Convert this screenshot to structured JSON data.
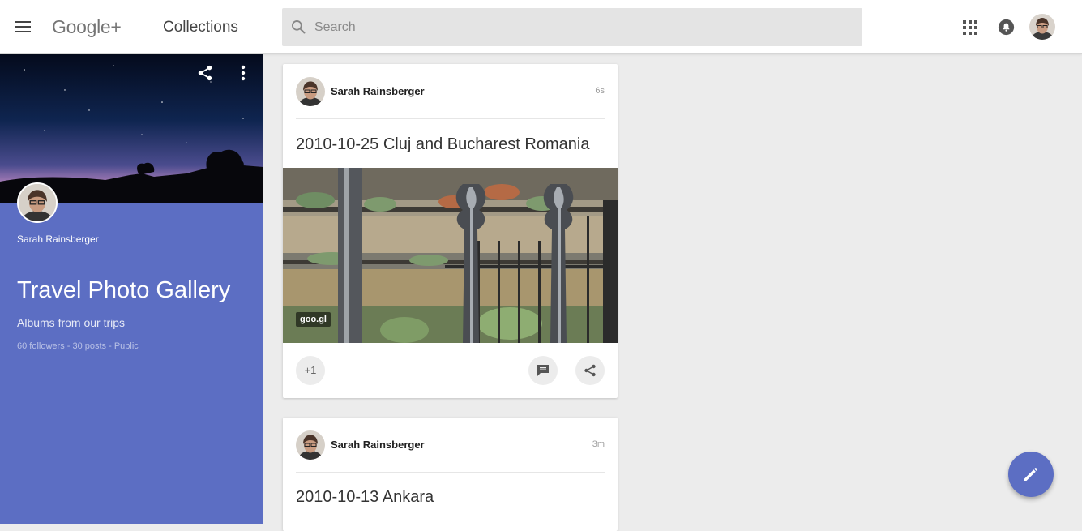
{
  "header": {
    "logo": "Google+",
    "section_title": "Collections",
    "search_placeholder": "Search"
  },
  "collection": {
    "owner_name": "Sarah Rainsberger",
    "title": "Travel Photo Gallery",
    "description": "Albums from our trips",
    "stats": "60 followers - 30 posts - Public"
  },
  "posts": [
    {
      "author": "Sarah Rainsberger",
      "time": "6s",
      "title": "2010-10-25 Cluj and Bucharest Romania",
      "image_tag": "goo.gl",
      "plus_one": "+1"
    },
    {
      "author": "Sarah Rainsberger",
      "time": "3m",
      "title": "2010-10-13 Ankara"
    }
  ],
  "colors": {
    "accent": "#5c6ec3",
    "background": "#ececec"
  },
  "icons": {
    "menu": "menu-icon",
    "search": "search-icon",
    "apps": "apps-grid-icon",
    "notifications": "notification-bell-icon",
    "share": "share-icon",
    "more": "more-vert-icon",
    "comment": "comment-icon",
    "compose": "pencil-icon"
  }
}
